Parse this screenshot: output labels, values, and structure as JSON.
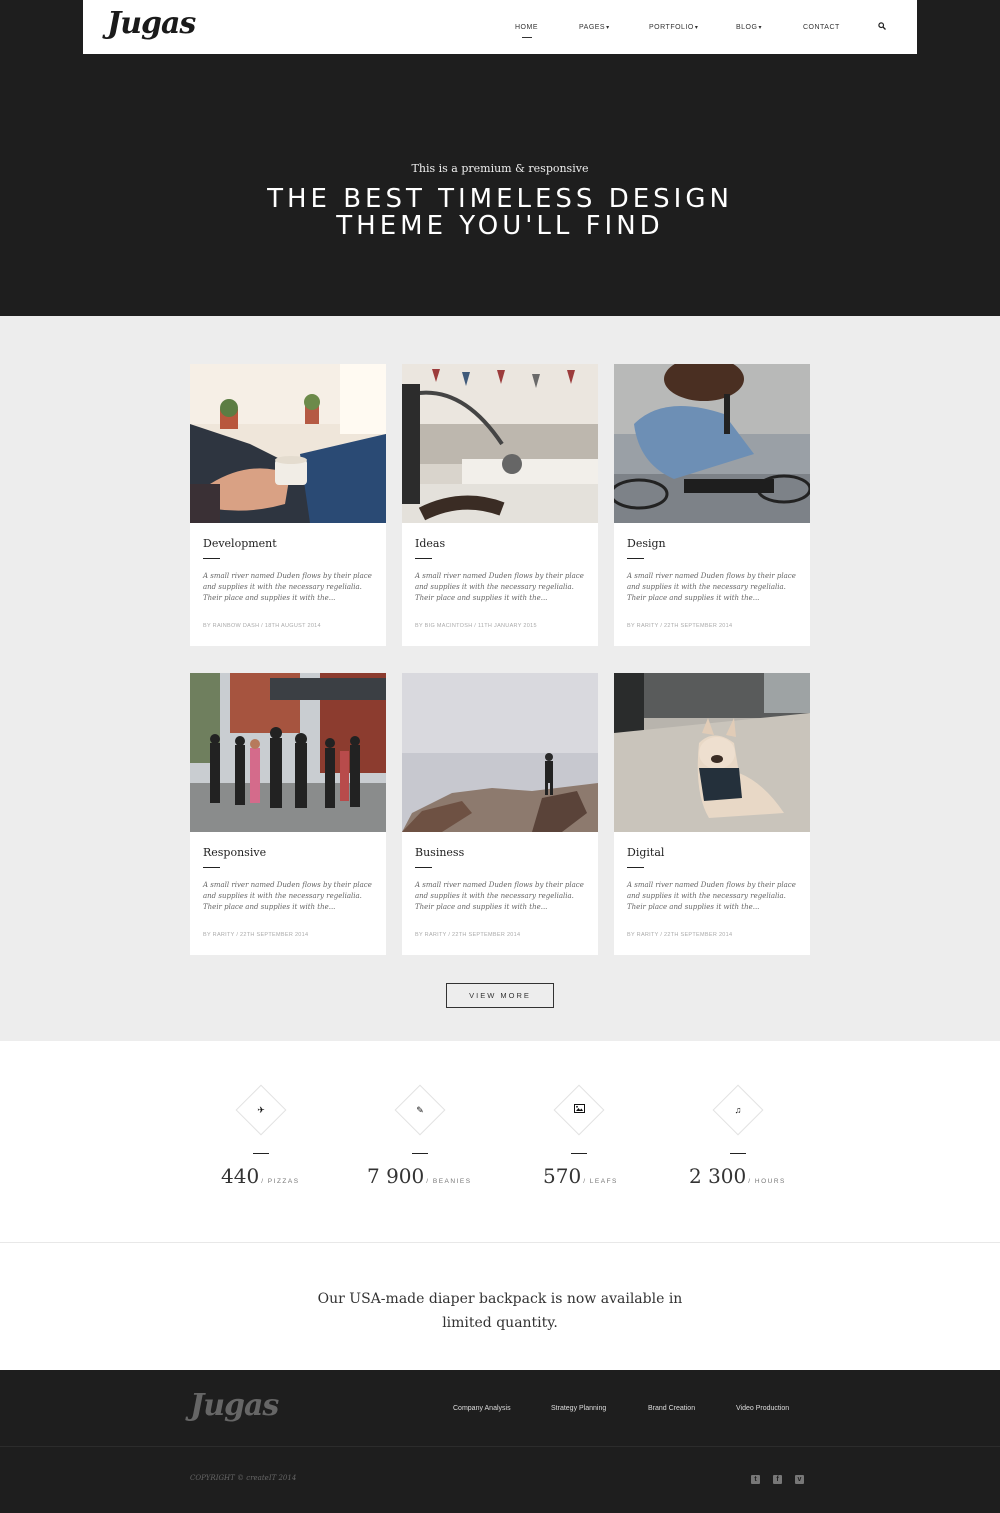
{
  "header": {
    "logo": "Jugas",
    "nav": [
      {
        "label": "HOME",
        "dropdown": false
      },
      {
        "label": "PAGES",
        "dropdown": true
      },
      {
        "label": "PORTFOLIO",
        "dropdown": true
      },
      {
        "label": "BLOG",
        "dropdown": true
      },
      {
        "label": "CONTACT",
        "dropdown": false
      }
    ],
    "search_icon": "search-icon"
  },
  "hero": {
    "subtitle": "This is a premium & responsive",
    "title_line1": "THE BEST TIMELESS DESIGN",
    "title_line2": "THEME YOU'LL FIND"
  },
  "posts": [
    {
      "title": "Development",
      "excerpt": "A small river named Duden flows by their place and supplies it with the necessary regelialia. Their place and supplies it with the...",
      "meta": "BY RAINBOW DASH / 18TH AUGUST 2014"
    },
    {
      "title": "Ideas",
      "excerpt": "A small river named Duden flows by their place and supplies it with the necessary regelialia. Their place and supplies it with the...",
      "meta": "BY BIG MACINTOSH / 11TH JANUARY 2015"
    },
    {
      "title": "Design",
      "excerpt": "A small river named Duden flows by their place and supplies it with the necessary regelialia. Their place and supplies it with the...",
      "meta": "BY RARITY / 22TH SEPTEMBER 2014"
    },
    {
      "title": "Responsive",
      "excerpt": "A small river named Duden flows by their place and supplies it with the necessary regelialia. Their place and supplies it with the...",
      "meta": "BY RARITY / 22TH SEPTEMBER 2014"
    },
    {
      "title": "Business",
      "excerpt": "A small river named Duden flows by their place and supplies it with the necessary regelialia. Their place and supplies it with the...",
      "meta": "BY RARITY / 22TH SEPTEMBER 2014"
    },
    {
      "title": "Digital",
      "excerpt": "A small river named Duden flows by their place and supplies it with the necessary regelialia. Their place and supplies it with the...",
      "meta": "BY RARITY / 22TH SEPTEMBER 2014"
    }
  ],
  "view_more": "VIEW MORE",
  "stats": [
    {
      "value": "440",
      "unit": "/ PIZZAS",
      "icon": "airplane-icon"
    },
    {
      "value": "7 900",
      "unit": "/ BEANIES",
      "icon": "pencil-icon"
    },
    {
      "value": "570",
      "unit": "/ LEAFS",
      "icon": "image-icon"
    },
    {
      "value": "2 300",
      "unit": "/ HOURS",
      "icon": "music-note-icon"
    }
  ],
  "quote": "Our USA-made diaper backpack is now available in limited quantity.",
  "footer": {
    "logo": "Jugas",
    "links": [
      "Company Analysis",
      "Strategy Planning",
      "Brand Creation",
      "Video Production"
    ],
    "copyright": "COPYRIGHT © createIT 2014",
    "social": [
      "twitter-icon",
      "facebook-icon",
      "vimeo-icon"
    ]
  }
}
